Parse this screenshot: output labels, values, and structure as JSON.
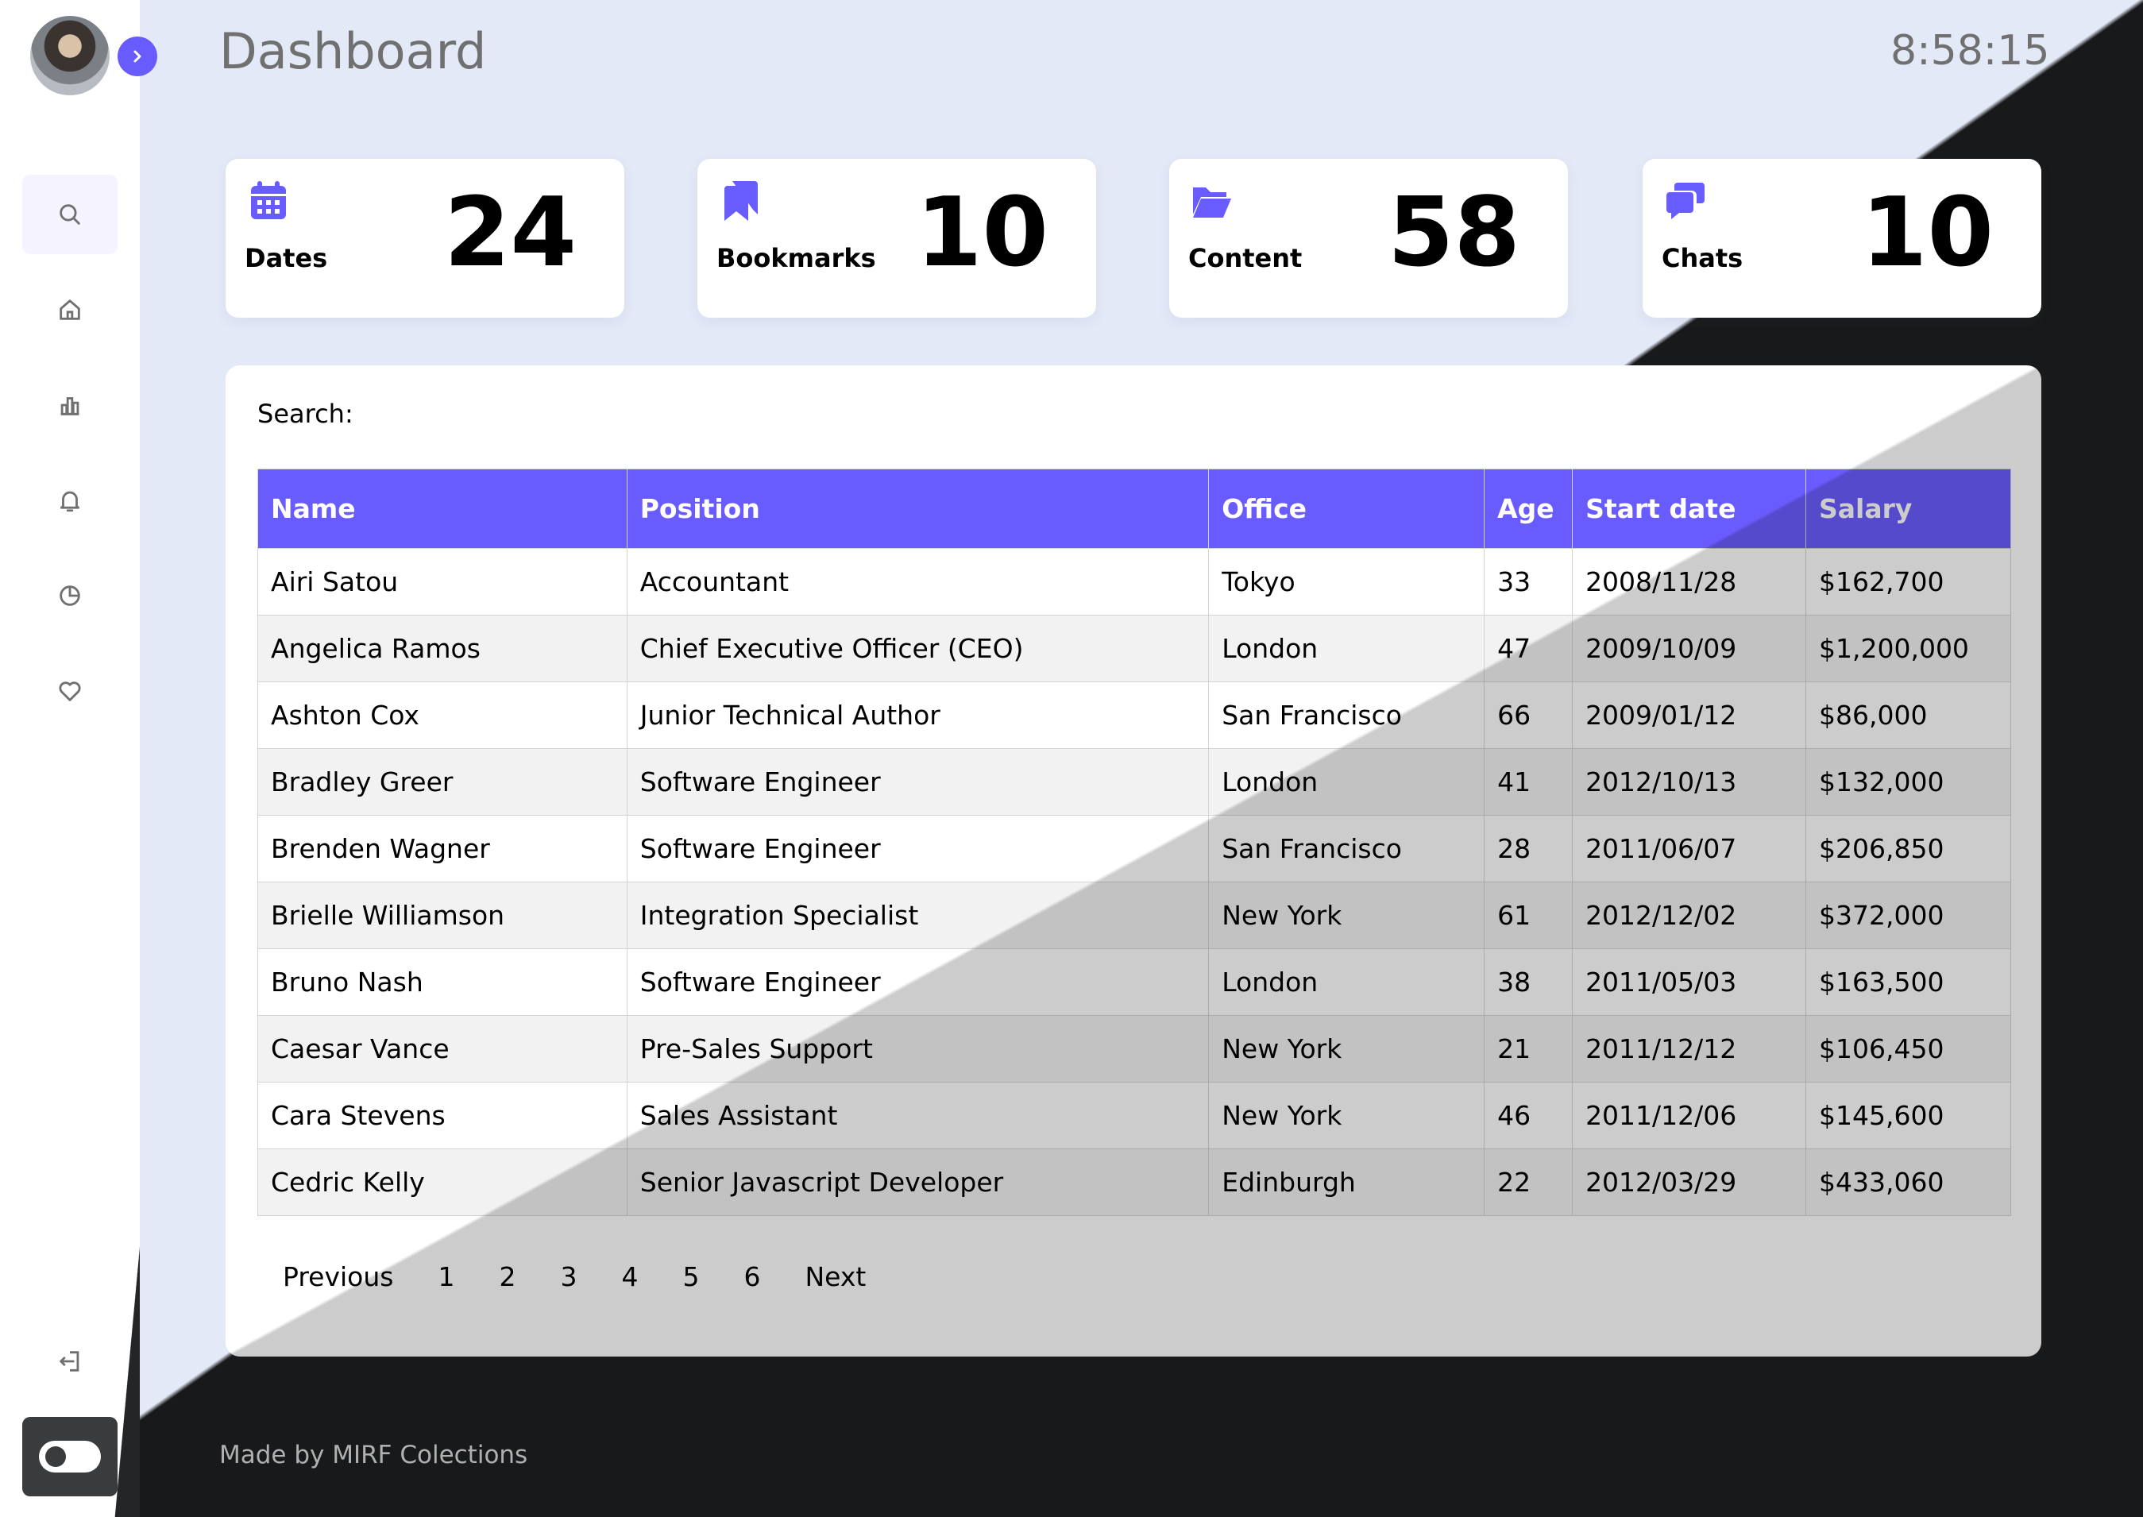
{
  "header": {
    "title": "Dashboard",
    "clock": "8:58:15"
  },
  "sidebar": {
    "items": [
      {
        "name": "search",
        "icon": "search-icon"
      },
      {
        "name": "home",
        "icon": "home-icon"
      },
      {
        "name": "analytics",
        "icon": "bar-chart-icon"
      },
      {
        "name": "notifications",
        "icon": "bell-icon"
      },
      {
        "name": "history",
        "icon": "pie-chart-icon"
      },
      {
        "name": "favorites",
        "icon": "heart-icon"
      }
    ],
    "logout_icon": "logout-icon",
    "mode_icon": "dark-mode-toggle"
  },
  "cards": [
    {
      "label": "Dates",
      "value": "24",
      "icon": "calendar-icon"
    },
    {
      "label": "Bookmarks",
      "value": "10",
      "icon": "bookmarks-icon"
    },
    {
      "label": "Content",
      "value": "58",
      "icon": "folder-open-icon"
    },
    {
      "label": "Chats",
      "value": "10",
      "icon": "chat-bubbles-icon"
    }
  ],
  "table": {
    "search_label": "Search:",
    "columns": [
      "Name",
      "Position",
      "Office",
      "Age",
      "Start date",
      "Salary"
    ],
    "rows": [
      [
        "Airi Satou",
        "Accountant",
        "Tokyo",
        "33",
        "2008/11/28",
        "$162,700"
      ],
      [
        "Angelica Ramos",
        "Chief Executive Officer (CEO)",
        "London",
        "47",
        "2009/10/09",
        "$1,200,000"
      ],
      [
        "Ashton Cox",
        "Junior Technical Author",
        "San Francisco",
        "66",
        "2009/01/12",
        "$86,000"
      ],
      [
        "Bradley Greer",
        "Software Engineer",
        "London",
        "41",
        "2012/10/13",
        "$132,000"
      ],
      [
        "Brenden Wagner",
        "Software Engineer",
        "San Francisco",
        "28",
        "2011/06/07",
        "$206,850"
      ],
      [
        "Brielle Williamson",
        "Integration Specialist",
        "New York",
        "61",
        "2012/12/02",
        "$372,000"
      ],
      [
        "Bruno Nash",
        "Software Engineer",
        "London",
        "38",
        "2011/05/03",
        "$163,500"
      ],
      [
        "Caesar Vance",
        "Pre-Sales Support",
        "New York",
        "21",
        "2011/12/12",
        "$106,450"
      ],
      [
        "Cara Stevens",
        "Sales Assistant",
        "New York",
        "46",
        "2011/12/06",
        "$145,600"
      ],
      [
        "Cedric Kelly",
        "Senior Javascript Developer",
        "Edinburgh",
        "22",
        "2012/03/29",
        "$433,060"
      ]
    ],
    "pagination": [
      "Previous",
      "1",
      "2",
      "3",
      "4",
      "5",
      "6",
      "Next"
    ]
  },
  "footer": {
    "text": "Made by MIRF Colections"
  },
  "colors": {
    "accent": "#695cfe",
    "background": "#e4e9f7",
    "dark": "#18191a"
  }
}
